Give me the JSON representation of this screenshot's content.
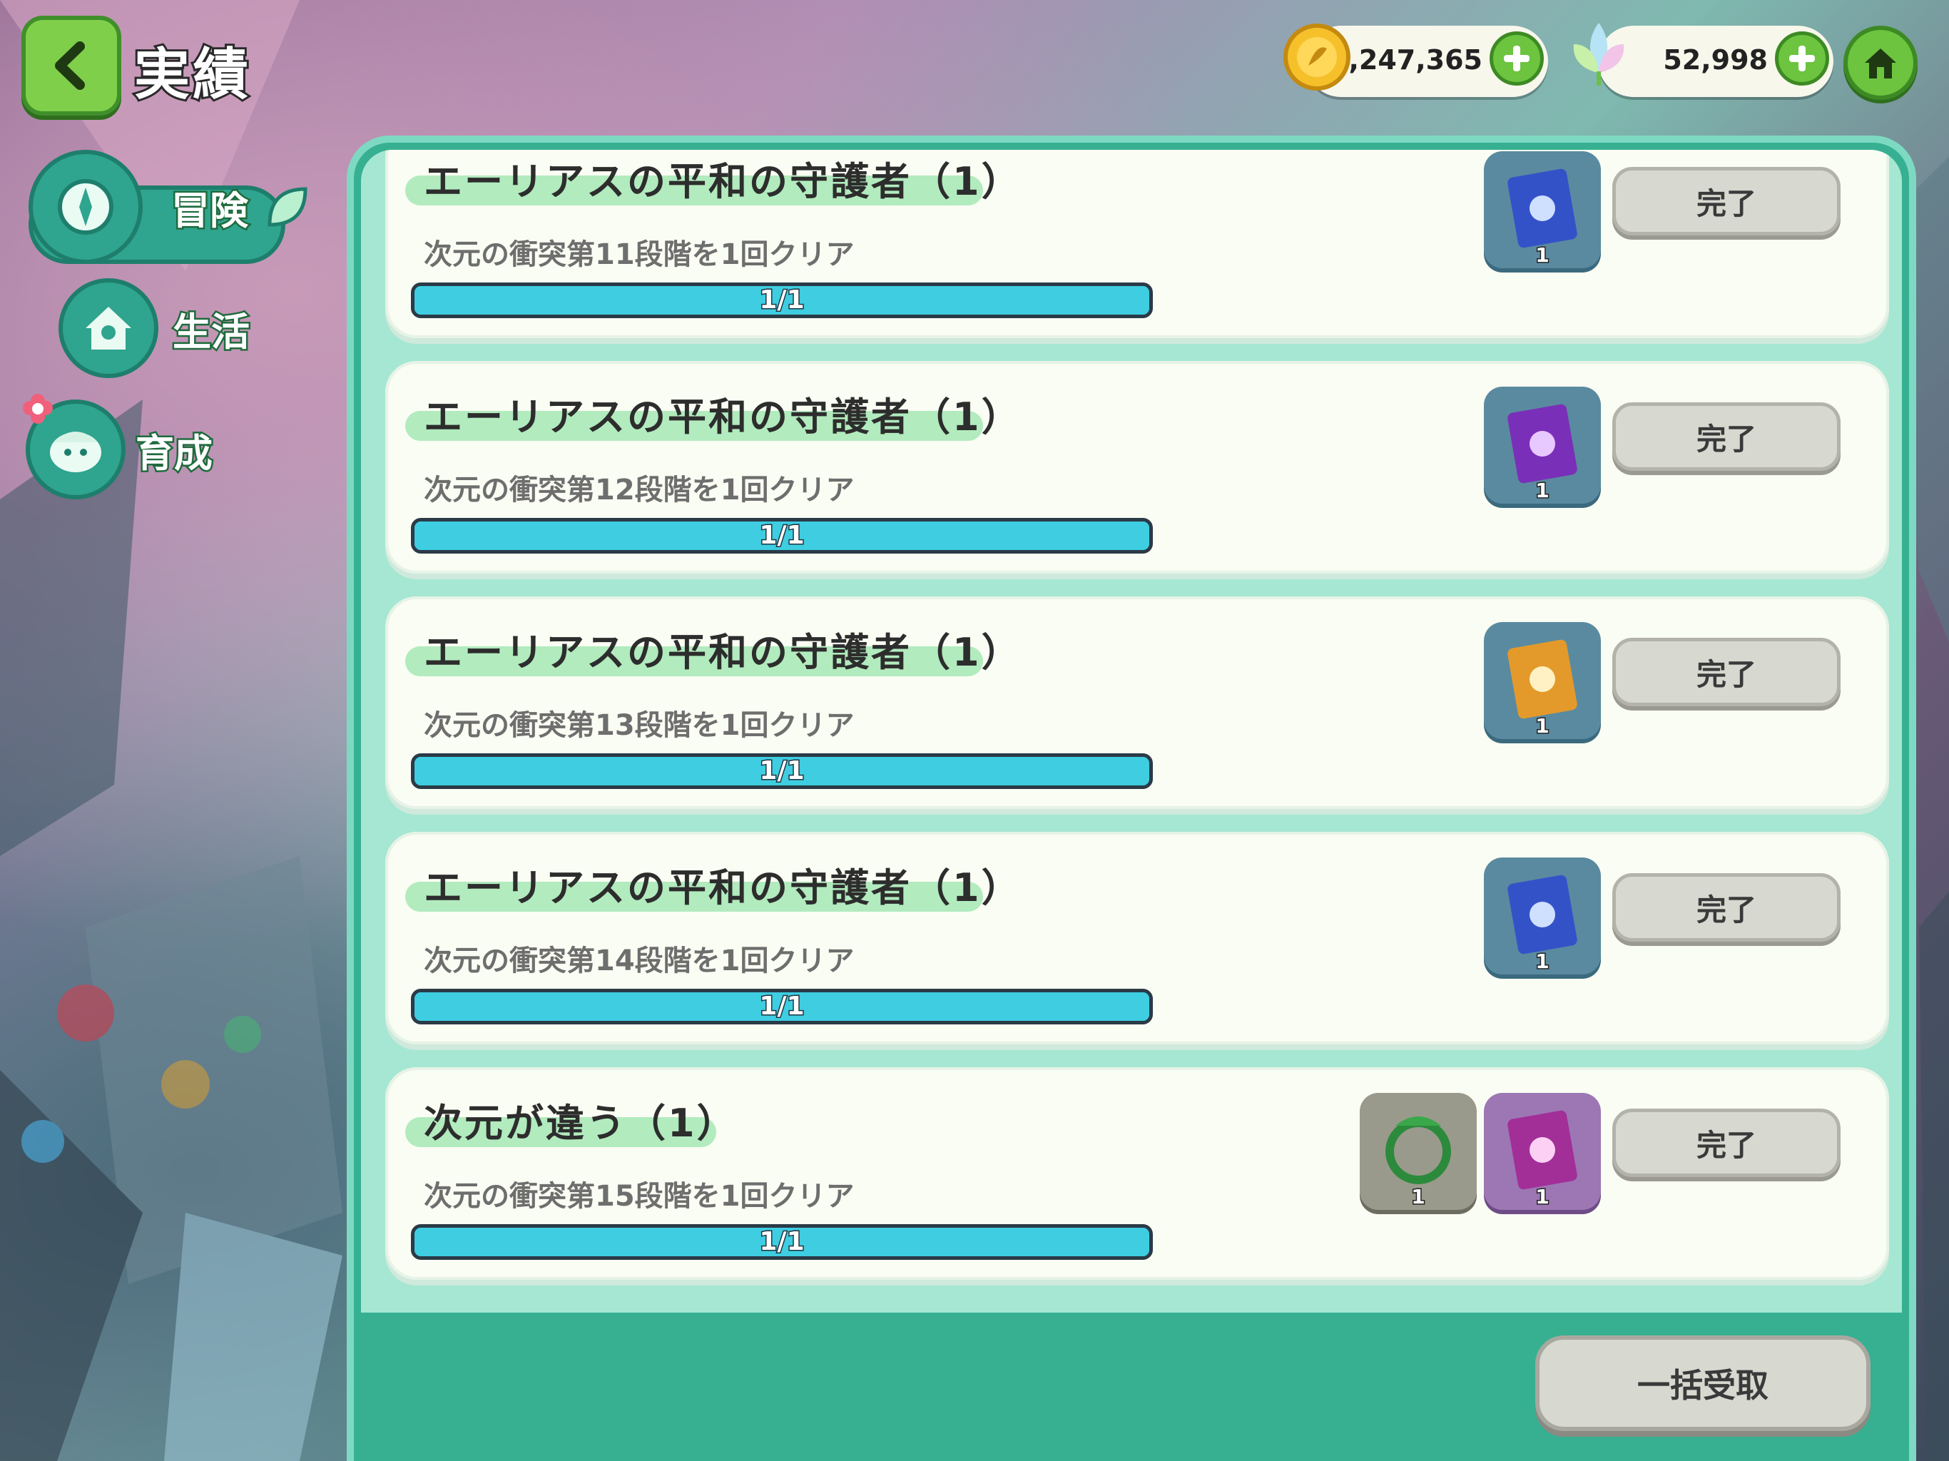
{
  "header": {
    "title": "実績",
    "coins": "1,247,365",
    "gems": "52,998"
  },
  "sidebar": {
    "tabs": [
      {
        "label": "冒険",
        "active": true
      },
      {
        "label": "生活",
        "active": false
      },
      {
        "label": "育成",
        "active": false
      }
    ]
  },
  "achievements": [
    {
      "title": "エーリアスの平和の守護者（1）",
      "desc": "次元の衝突第11段階を1回クリア",
      "progress": "1/1",
      "rewards": [
        {
          "icon": "blue-ticket-icon",
          "qty": "1"
        }
      ],
      "button": "完了"
    },
    {
      "title": "エーリアスの平和の守護者（1）",
      "desc": "次元の衝突第12段階を1回クリア",
      "progress": "1/1",
      "rewards": [
        {
          "icon": "purple-ticket-icon",
          "qty": "1"
        }
      ],
      "button": "完了"
    },
    {
      "title": "エーリアスの平和の守護者（1）",
      "desc": "次元の衝突第13段階を1回クリア",
      "progress": "1/1",
      "rewards": [
        {
          "icon": "gold-ticket-icon",
          "qty": "1"
        }
      ],
      "button": "完了"
    },
    {
      "title": "エーリアスの平和の守護者（1）",
      "desc": "次元の衝突第14段階を1回クリア",
      "progress": "1/1",
      "rewards": [
        {
          "icon": "blue-ticket-icon",
          "qty": "1"
        }
      ],
      "button": "完了"
    },
    {
      "title": "次元が違う（1）",
      "desc": "次元の衝突第15段階を1回クリア",
      "progress": "1/1",
      "rewards": [
        {
          "icon": "frame-icon",
          "qty": "1"
        },
        {
          "icon": "purple-ticket-icon",
          "qty": "1"
        }
      ],
      "button": "完了"
    }
  ],
  "bulk_button": "一括受取",
  "colors": {
    "accent": "#37b092",
    "progress": "#3ecde1",
    "button_green": "#6cc43f"
  }
}
